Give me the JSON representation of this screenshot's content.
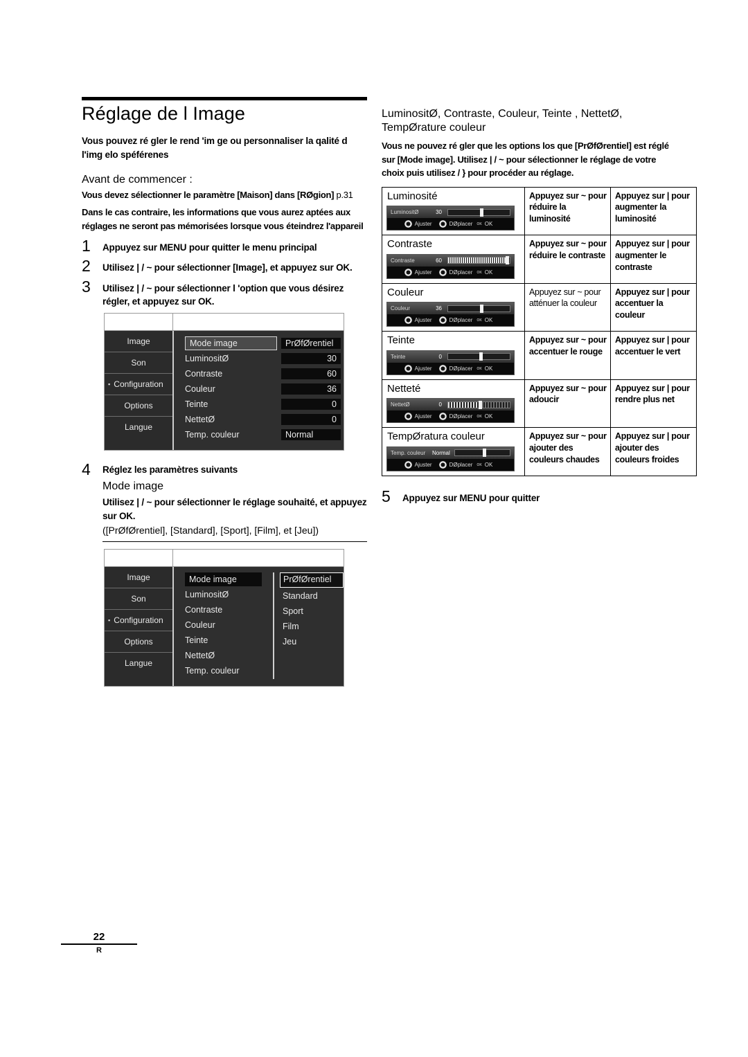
{
  "document": {
    "title": "Réglage de l Image",
    "lead": "Vous pouvez ré gler le rend 'im ge ou personnaliser la qalité d l'img elo spéférenes",
    "before_heading": "Avant de commencer :",
    "before_note_1": "Vous devez sélectionner le paramètre [Maison] dans [RØgion]",
    "before_note_ref": "p.31",
    "before_note_2": "Dans le cas contraire, les informations que vous aurez aptées aux réglages ne seront pas mémorisées lorsque vous éteindrez l'appareil"
  },
  "steps": [
    {
      "num": "1",
      "text": "Appuyez sur MENU pour quitter le menu principal",
      "reg_parts": "MENU"
    },
    {
      "num": "2",
      "text": "Utilisez | / ~ pour sélectionner [Image], et appuyez sur OK."
    },
    {
      "num": "3",
      "text": "Utilisez | / ~ pour sélectionner l 'option que vous désirez régler, et appuyez sur OK."
    },
    {
      "num": "4",
      "text": "Réglez les paramètres suivants",
      "sub": "Mode image",
      "body": "Utilisez | / ~ pour sélectionner le réglage souhaité, et appuyez sur OK.",
      "options_line": "([PrØfØrentiel], [Standard], [Sport], [Film], et [Jeu])"
    },
    {
      "num": "5",
      "text": "Appuyez sur MENU pour quitter"
    }
  ],
  "tv_menu_1": {
    "sidebar": [
      {
        "label": "Image",
        "marked": false
      },
      {
        "label": "Son",
        "marked": false
      },
      {
        "label": "Configuration",
        "marked": true
      },
      {
        "label": "Options",
        "marked": false
      },
      {
        "label": "Langue",
        "marked": false
      }
    ],
    "rows": [
      {
        "label": "Mode image",
        "value": "PrØfØrentiel",
        "highlight": true,
        "value_align": "left"
      },
      {
        "label": "LuminositØ",
        "value": "30",
        "highlight": false,
        "value_align": "right"
      },
      {
        "label": "Contraste",
        "value": "60",
        "highlight": false,
        "value_align": "right"
      },
      {
        "label": "Couleur",
        "value": "36",
        "highlight": false,
        "value_align": "right"
      },
      {
        "label": "Teinte",
        "value": "0",
        "highlight": false,
        "value_align": "right"
      },
      {
        "label": "NettetØ",
        "value": "0",
        "highlight": false,
        "value_align": "right"
      },
      {
        "label": "Temp. couleur",
        "value": "Normal",
        "highlight": false,
        "value_align": "left"
      }
    ]
  },
  "tv_menu_2": {
    "sidebar": [
      {
        "label": "Image",
        "marked": false
      },
      {
        "label": "Son",
        "marked": false
      },
      {
        "label": "Configuration",
        "marked": true
      },
      {
        "label": "Options",
        "marked": false
      },
      {
        "label": "Langue",
        "marked": false
      }
    ],
    "rows": [
      {
        "label": "Mode image",
        "highlight": true
      },
      {
        "label": "LuminositØ",
        "highlight": false
      },
      {
        "label": "Contraste",
        "highlight": false
      },
      {
        "label": "Couleur",
        "highlight": false
      },
      {
        "label": "Teinte",
        "highlight": false
      },
      {
        "label": "NettetØ",
        "highlight": false
      },
      {
        "label": "Temp. couleur",
        "highlight": false
      }
    ],
    "options": [
      {
        "label": "PrØfØrentiel",
        "selected": true
      },
      {
        "label": "Standard",
        "selected": false
      },
      {
        "label": "Sport",
        "selected": false
      },
      {
        "label": "Film",
        "selected": false
      },
      {
        "label": "Jeu",
        "selected": false
      }
    ]
  },
  "right_column": {
    "heading": "LuminositØ, Contraste, Couleur, Teinte , NettetØ, TempØrature couleur",
    "intro": "Vous ne pouvez ré gler que les options los que [PrØfØrentiel] est réglé sur [Mode image]. Utilisez | / ~ pour sélectionner le réglage de votre choix puis utilisez / } pour procéder au réglage."
  },
  "osd_labels": {
    "adjust": "Ajuster",
    "move": "DØplacer",
    "ok": "OK",
    "ok_prefix": "oĸ"
  },
  "control_table": {
    "rows": [
      {
        "name": "Luminosité",
        "osd": {
          "label": "LuminositØ",
          "value": "30",
          "fill": 0,
          "knob": 52,
          "style": "plain"
        },
        "decrease": "Appuyez sur ~ pour réduire la luminosité",
        "increase": "Appuyez sur | pour augmenter la luminosité"
      },
      {
        "name": "Contraste",
        "osd": {
          "label": "Contraste",
          "value": "60",
          "fill": 94,
          "knob": 93,
          "style": "zig"
        },
        "decrease": "Appuyez sur ~ pour réduire le contraste",
        "increase": "Appuyez sur | pour augmenter le contraste"
      },
      {
        "name": "Couleur",
        "osd": {
          "label": "Couleur",
          "value": "36",
          "fill": 0,
          "knob": 52,
          "style": "plain"
        },
        "decrease": "Appuyez sur ~ pour atténuer la couleur",
        "increase": "Appuyez sur | pour accentuer la couleur"
      },
      {
        "name": "Teinte",
        "osd": {
          "label": "Teinte",
          "value": "0",
          "fill": 0,
          "knob": 50,
          "style": "plain"
        },
        "decrease": "Appuyez sur ~ pour accentuer le rouge",
        "increase": "Appuyez sur | pour accentuer le vert"
      },
      {
        "name": "Netteté",
        "osd": {
          "label": "NettetØ",
          "value": "0",
          "fill": 50,
          "knob": 49,
          "style": "dots"
        },
        "decrease": "Appuyez sur ~ pour adoucir",
        "increase": "Appuyez sur | pour rendre plus net"
      },
      {
        "name": "TempØratura couleur",
        "osd": {
          "label": "Temp. couleur",
          "value": "Normal",
          "fill": 0,
          "knob": 50,
          "style": "plain"
        },
        "decrease": "Appuyez sur ~ pour ajouter des couleurs chaudes",
        "increase": "Appuyez sur | pour ajouter des couleurs froides"
      }
    ]
  },
  "footer": {
    "page_number": "22",
    "language_code": "R"
  }
}
